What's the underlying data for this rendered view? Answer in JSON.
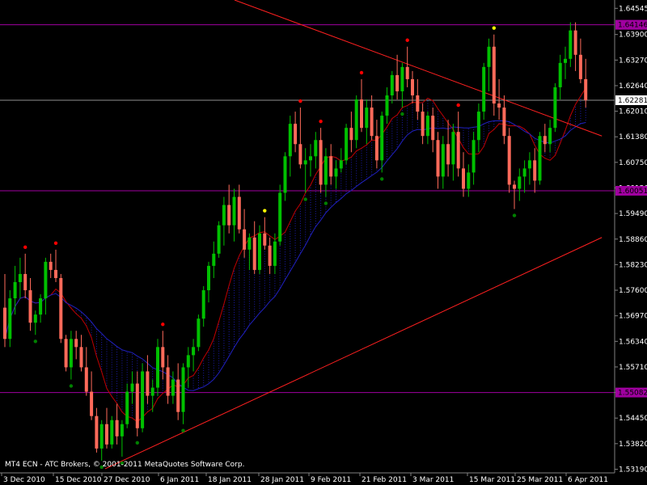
{
  "app": {
    "credit": "MT4 ECN - ATC Brokers, © 2001-2011 MetaQuotes Software Corp."
  },
  "chart_data": {
    "type": "candlestick",
    "title": "",
    "ylim": [
      1.531,
      1.6475
    ],
    "y_ticks": [
      "1.64545",
      "1.63900",
      "1.63270",
      "1.62640",
      "1.62010",
      "1.61380",
      "1.60750",
      "1.60120",
      "1.59490",
      "1.58860",
      "1.58230",
      "1.57600",
      "1.56970",
      "1.56340",
      "1.55710",
      "1.55080",
      "1.54450",
      "1.53820",
      "1.53190"
    ],
    "x_ticks": [
      "3 Dec 2010",
      "15 Dec 2010",
      "27 Dec 2010",
      "6 Jan 2011",
      "18 Jan 2011",
      "28 Jan 2011",
      "9 Feb 2011",
      "21 Feb 2011",
      "3 Mar 2011",
      "15 Mar 2011",
      "25 Mar 2011",
      "6 Apr 2011"
    ],
    "current_price": "1.62281",
    "horizontal_levels": [
      {
        "value": 1.6414,
        "label": "1.64146"
      },
      {
        "value": 1.6005,
        "label": "1.60051"
      },
      {
        "value": 1.5508,
        "label": "1.55082"
      }
    ],
    "trendlines": [
      {
        "from_date": "6 Jan 2011",
        "from_price": 1.653,
        "to_date": "after 6 Apr 2011",
        "to_price": 1.614
      },
      {
        "from_date": "27 Dec 2010",
        "from_price": 1.532,
        "to_date": "after 6 Apr 2011",
        "to_price": 1.589
      }
    ],
    "colors": {
      "bull": "#00c000",
      "bear": "#ff6a5a",
      "level": "#a000a0",
      "trendline": "#ff2020",
      "cloud": "#2020c0",
      "ma": "#c00000",
      "fractal_up": "#ff0000",
      "fractal_yellow": "#ffff00",
      "fractal_down": "#008000"
    },
    "candles": [
      [
        1.5717,
        1.58,
        1.562,
        1.564
      ],
      [
        1.564,
        1.576,
        1.562,
        1.574
      ],
      [
        1.574,
        1.582,
        1.57,
        1.578
      ],
      [
        1.578,
        1.584,
        1.574,
        1.58
      ],
      [
        1.58,
        1.585,
        1.574,
        1.576
      ],
      [
        1.576,
        1.579,
        1.566,
        1.568
      ],
      [
        1.568,
        1.571,
        1.565,
        1.57
      ],
      [
        1.57,
        1.575,
        1.568,
        1.574
      ],
      [
        1.574,
        1.584,
        1.57,
        1.583
      ],
      [
        1.583,
        1.585,
        1.579,
        1.581
      ],
      [
        1.581,
        1.586,
        1.578,
        1.579
      ],
      [
        1.579,
        1.58,
        1.563,
        1.564
      ],
      [
        1.564,
        1.565,
        1.556,
        1.557
      ],
      [
        1.557,
        1.566,
        1.554,
        1.564
      ],
      [
        1.564,
        1.566,
        1.559,
        1.562
      ],
      [
        1.562,
        1.565,
        1.556,
        1.557
      ],
      [
        1.557,
        1.562,
        1.55,
        1.551
      ],
      [
        1.551,
        1.556,
        1.544,
        1.545
      ],
      [
        1.545,
        1.547,
        1.536,
        1.537
      ],
      [
        1.537,
        1.544,
        1.534,
        1.543
      ],
      [
        1.543,
        1.547,
        1.537,
        1.538
      ],
      [
        1.538,
        1.545,
        1.537,
        1.544
      ],
      [
        1.544,
        1.548,
        1.538,
        1.54
      ],
      [
        1.54,
        1.544,
        1.535,
        1.543
      ],
      [
        1.543,
        1.553,
        1.542,
        1.551
      ],
      [
        1.551,
        1.556,
        1.548,
        1.553
      ],
      [
        1.553,
        1.556,
        1.54,
        1.542
      ],
      [
        1.542,
        1.558,
        1.541,
        1.556
      ],
      [
        1.556,
        1.56,
        1.548,
        1.55
      ],
      [
        1.55,
        1.554,
        1.546,
        1.552
      ],
      [
        1.552,
        1.564,
        1.55,
        1.562
      ],
      [
        1.562,
        1.566,
        1.554,
        1.557
      ],
      [
        1.557,
        1.56,
        1.548,
        1.55
      ],
      [
        1.55,
        1.556,
        1.548,
        1.554
      ],
      [
        1.554,
        1.558,
        1.544,
        1.546
      ],
      [
        1.546,
        1.558,
        1.543,
        1.557
      ],
      [
        1.557,
        1.562,
        1.552,
        1.56
      ],
      [
        1.56,
        1.564,
        1.556,
        1.562
      ],
      [
        1.562,
        1.57,
        1.561,
        1.569
      ],
      [
        1.569,
        1.577,
        1.567,
        1.576
      ],
      [
        1.576,
        1.583,
        1.573,
        1.582
      ],
      [
        1.582,
        1.588,
        1.579,
        1.585
      ],
      [
        1.585,
        1.593,
        1.584,
        1.592
      ],
      [
        1.592,
        1.599,
        1.587,
        1.597
      ],
      [
        1.597,
        1.602,
        1.59,
        1.592
      ],
      [
        1.592,
        1.601,
        1.588,
        1.599
      ],
      [
        1.599,
        1.602,
        1.59,
        1.591
      ],
      [
        1.591,
        1.596,
        1.584,
        1.586
      ],
      [
        1.586,
        1.59,
        1.581,
        1.589
      ],
      [
        1.589,
        1.593,
        1.58,
        1.581
      ],
      [
        1.581,
        1.592,
        1.58,
        1.59
      ],
      [
        1.59,
        1.594,
        1.586,
        1.587
      ],
      [
        1.587,
        1.589,
        1.58,
        1.582
      ],
      [
        1.582,
        1.59,
        1.58,
        1.588
      ],
      [
        1.588,
        1.602,
        1.587,
        1.6
      ],
      [
        1.6,
        1.61,
        1.598,
        1.609
      ],
      [
        1.609,
        1.619,
        1.604,
        1.617
      ],
      [
        1.617,
        1.62,
        1.61,
        1.612
      ],
      [
        1.612,
        1.621,
        1.606,
        1.607
      ],
      [
        1.607,
        1.611,
        1.6,
        1.608
      ],
      [
        1.608,
        1.612,
        1.604,
        1.609
      ],
      [
        1.609,
        1.615,
        1.606,
        1.613
      ],
      [
        1.613,
        1.616,
        1.6,
        1.602
      ],
      [
        1.602,
        1.611,
        1.599,
        1.609
      ],
      [
        1.609,
        1.612,
        1.602,
        1.604
      ],
      [
        1.604,
        1.608,
        1.601,
        1.606
      ],
      [
        1.606,
        1.611,
        1.605,
        1.608
      ],
      [
        1.608,
        1.617,
        1.607,
        1.616
      ],
      [
        1.616,
        1.62,
        1.61,
        1.613
      ],
      [
        1.613,
        1.624,
        1.611,
        1.623
      ],
      [
        1.623,
        1.628,
        1.615,
        1.616
      ],
      [
        1.616,
        1.623,
        1.612,
        1.621
      ],
      [
        1.621,
        1.624,
        1.613,
        1.614
      ],
      [
        1.614,
        1.618,
        1.606,
        1.608
      ],
      [
        1.608,
        1.62,
        1.605,
        1.619
      ],
      [
        1.619,
        1.626,
        1.617,
        1.624
      ],
      [
        1.624,
        1.63,
        1.622,
        1.629
      ],
      [
        1.629,
        1.634,
        1.623,
        1.625
      ],
      [
        1.625,
        1.632,
        1.621,
        1.631
      ],
      [
        1.631,
        1.636,
        1.626,
        1.628
      ],
      [
        1.628,
        1.63,
        1.622,
        1.624
      ],
      [
        1.624,
        1.628,
        1.618,
        1.62
      ],
      [
        1.62,
        1.622,
        1.612,
        1.614
      ],
      [
        1.614,
        1.62,
        1.612,
        1.619
      ],
      [
        1.619,
        1.621,
        1.61,
        1.613
      ],
      [
        1.613,
        1.615,
        1.601,
        1.604
      ],
      [
        1.604,
        1.614,
        1.601,
        1.612
      ],
      [
        1.612,
        1.618,
        1.604,
        1.607
      ],
      [
        1.607,
        1.617,
        1.603,
        1.615
      ],
      [
        1.615,
        1.62,
        1.604,
        1.606
      ],
      [
        1.606,
        1.61,
        1.599,
        1.601
      ],
      [
        1.601,
        1.607,
        1.599,
        1.605
      ],
      [
        1.605,
        1.615,
        1.602,
        1.613
      ],
      [
        1.613,
        1.622,
        1.61,
        1.62
      ],
      [
        1.62,
        1.632,
        1.618,
        1.631
      ],
      [
        1.631,
        1.638,
        1.625,
        1.636
      ],
      [
        1.636,
        1.639,
        1.619,
        1.622
      ],
      [
        1.622,
        1.628,
        1.618,
        1.621
      ],
      [
        1.621,
        1.624,
        1.612,
        1.614
      ],
      [
        1.614,
        1.616,
        1.6,
        1.602
      ],
      [
        1.602,
        1.603,
        1.596,
        1.601
      ],
      [
        1.601,
        1.606,
        1.598,
        1.604
      ],
      [
        1.604,
        1.608,
        1.6,
        1.606
      ],
      [
        1.606,
        1.61,
        1.602,
        1.608
      ],
      [
        1.608,
        1.611,
        1.6,
        1.603
      ],
      [
        1.603,
        1.615,
        1.602,
        1.614
      ],
      [
        1.614,
        1.617,
        1.61,
        1.612
      ],
      [
        1.612,
        1.618,
        1.61,
        1.616
      ],
      [
        1.616,
        1.627,
        1.615,
        1.626
      ],
      [
        1.626,
        1.634,
        1.623,
        1.632
      ],
      [
        1.632,
        1.636,
        1.628,
        1.633
      ],
      [
        1.633,
        1.642,
        1.631,
        1.64
      ],
      [
        1.64,
        1.642,
        1.63,
        1.634
      ],
      [
        1.634,
        1.638,
        1.627,
        1.628
      ],
      [
        1.628,
        1.633,
        1.621,
        1.6228
      ]
    ]
  }
}
